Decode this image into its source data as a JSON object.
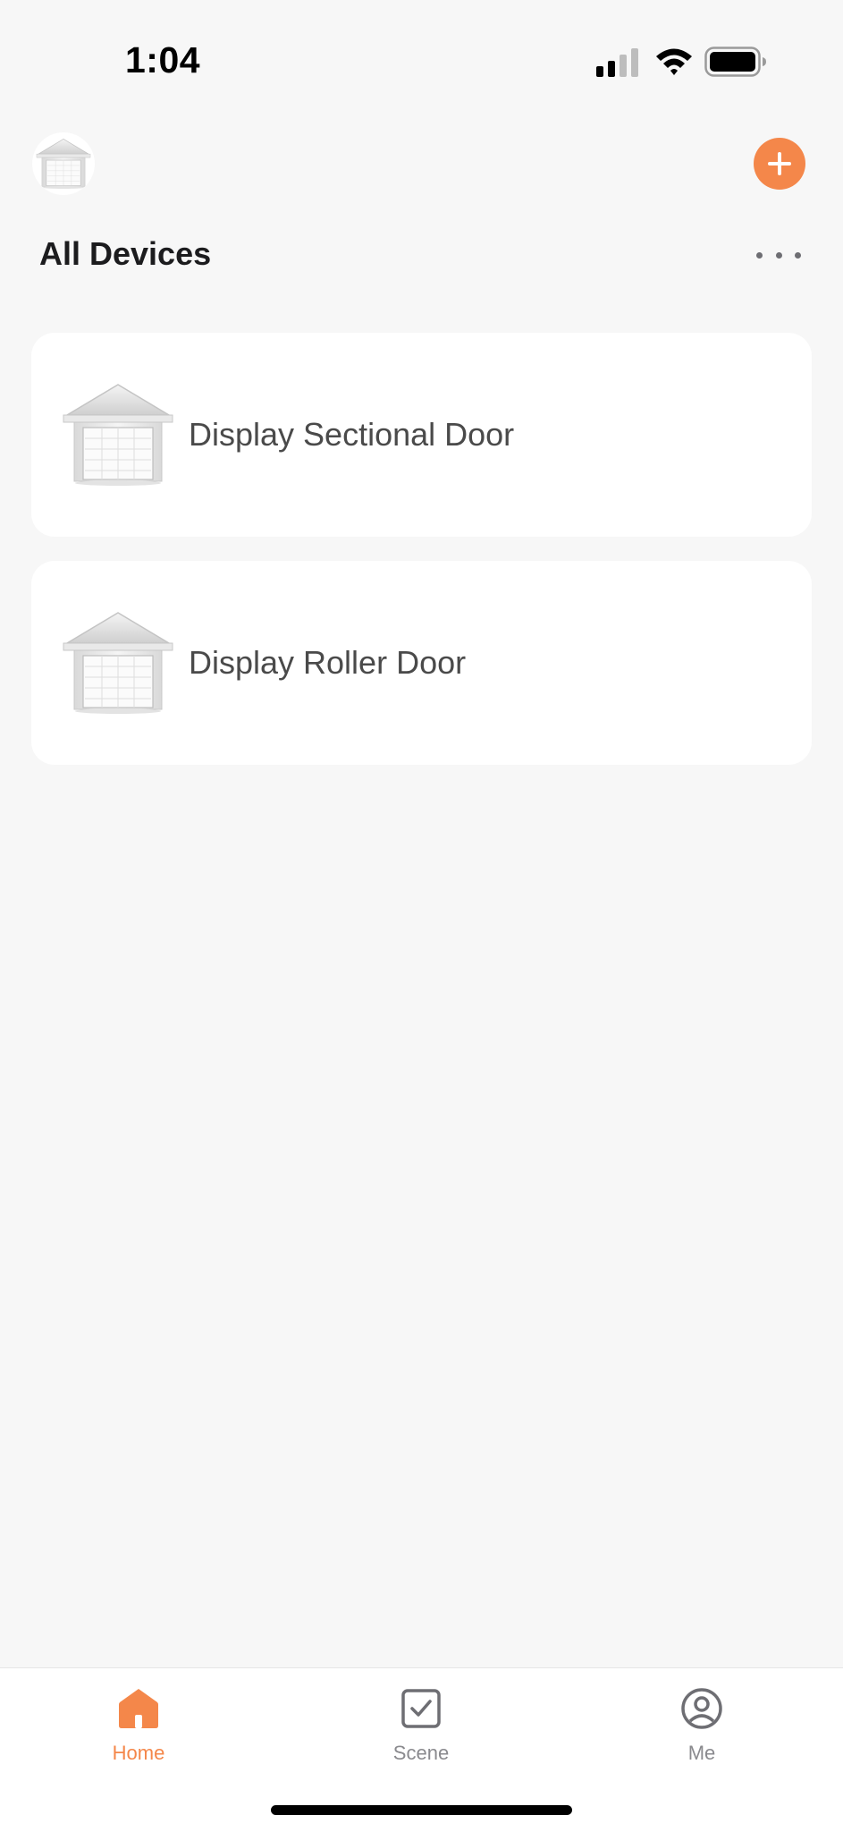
{
  "status_bar": {
    "time": "1:04",
    "icons": [
      "signal-icon",
      "wifi-icon",
      "battery-icon"
    ]
  },
  "header": {
    "avatar_icon": "garage-icon",
    "add_icon": "plus-icon",
    "title": "All Devices",
    "more_icon": "more-dots-icon"
  },
  "devices": [
    {
      "name": "Display Sectional Door",
      "icon": "garage-door-icon"
    },
    {
      "name": "Display Roller Door",
      "icon": "garage-door-icon"
    }
  ],
  "tab_bar": {
    "tabs": [
      {
        "label": "Home",
        "icon": "home-icon",
        "active": true
      },
      {
        "label": "Scene",
        "icon": "scene-checkbox-icon",
        "active": false
      },
      {
        "label": "Me",
        "icon": "profile-icon",
        "active": false
      }
    ]
  },
  "colors": {
    "accent": "#f4874a",
    "background": "#f7f7f7",
    "card": "#ffffff",
    "inactive_tab": "#8a8a8e"
  }
}
